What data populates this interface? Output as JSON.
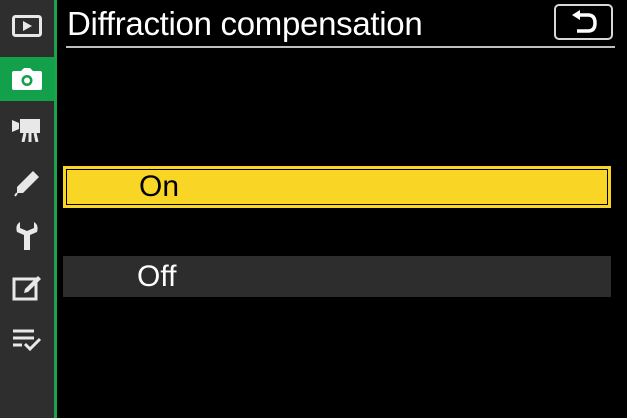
{
  "screen": {
    "title": "Diffraction compensation",
    "back_icon": "return-arrow-icon"
  },
  "sidebar": {
    "items": [
      {
        "icon": "playback-icon",
        "active": false
      },
      {
        "icon": "camera-icon",
        "active": true
      },
      {
        "icon": "movie-camera-icon",
        "active": false
      },
      {
        "icon": "pencil-icon",
        "active": false
      },
      {
        "icon": "wrench-icon",
        "active": false
      },
      {
        "icon": "retouch-icon",
        "active": false
      },
      {
        "icon": "my-menu-icon",
        "active": false
      }
    ]
  },
  "options": [
    {
      "label": "On",
      "selected": true
    },
    {
      "label": "Off",
      "selected": false
    }
  ],
  "colors": {
    "accent_green": "#13a04a",
    "highlight_yellow": "#f9d526",
    "row_gray": "#2d2d2d",
    "sidebar_gray": "#2e2e2e"
  }
}
